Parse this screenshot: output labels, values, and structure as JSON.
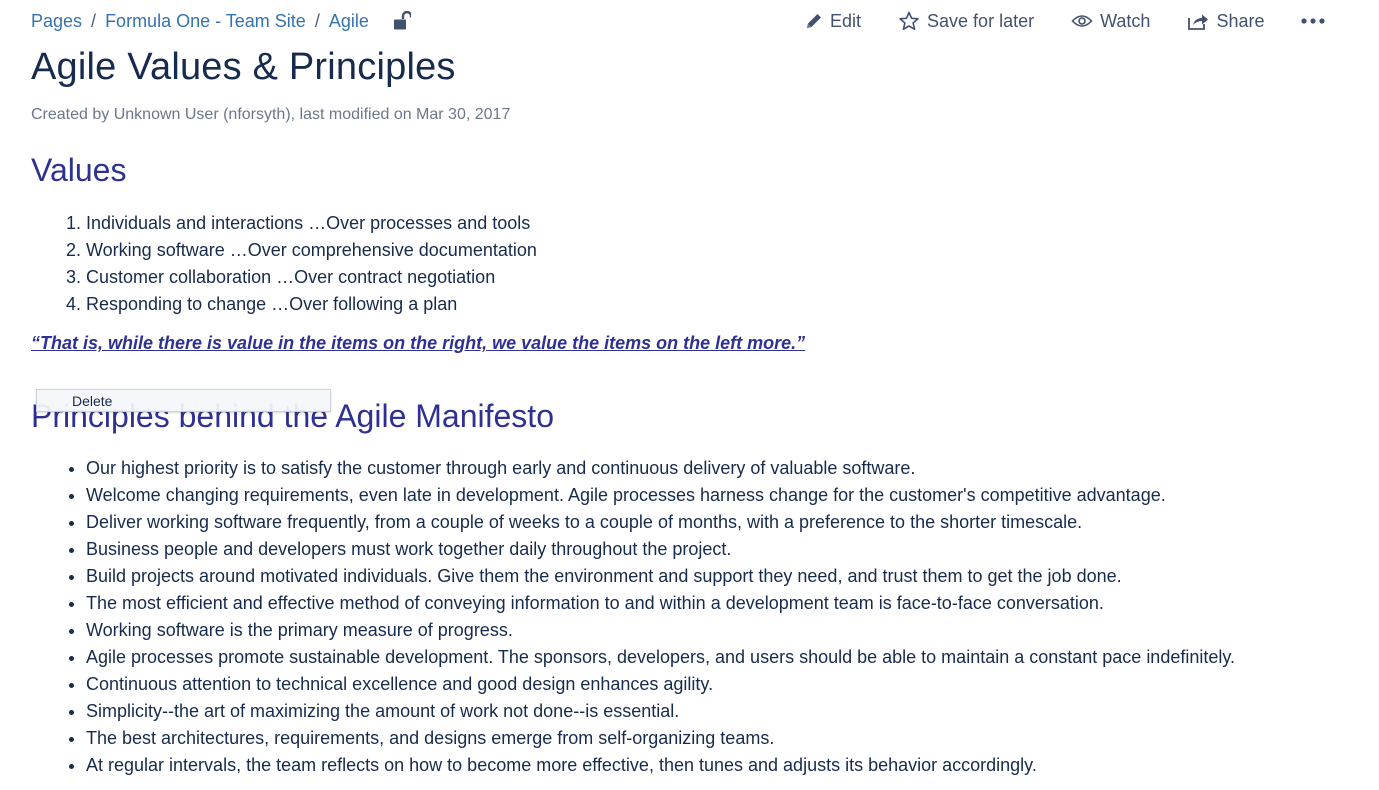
{
  "breadcrumbs": {
    "items": [
      "Pages",
      "Formula One - Team Site",
      "Agile"
    ],
    "separator": "/"
  },
  "actions": {
    "edit": "Edit",
    "save_for_later": "Save for later",
    "watch": "Watch",
    "share": "Share"
  },
  "page": {
    "title": "Agile Values & Principles",
    "byline": "Created by Unknown User (nforsyth), last modified on Mar 30, 2017"
  },
  "values_section": {
    "heading": "Values",
    "items": [
      "Individuals and interactions …Over processes and tools",
      "Working software …Over comprehensive documentation",
      "Customer collaboration …Over contract negotiation",
      "Responding to change …Over following a plan"
    ],
    "quote": "“That is, while there is value in the items on the right, we value the items on the left more.”"
  },
  "context_menu": {
    "delete_label": "Delete"
  },
  "principles_section": {
    "heading": "Principles behind the Agile Manifesto",
    "items": [
      "Our highest priority is to satisfy the customer through early and continuous delivery of valuable software.",
      "Welcome changing requirements, even late in development. Agile processes harness change for the customer's competitive advantage.",
      "Deliver working software frequently, from a couple of weeks to a couple of months, with a preference to the shorter timescale.",
      "Business people and developers must work together daily throughout the project.",
      "Build projects around motivated individuals. Give them the environment and support they need, and trust them to get the job done.",
      "The most efficient and effective method of conveying information to and within a development team is face-to-face conversation.",
      "Working software is the primary measure of progress.",
      "Agile processes promote sustainable development. The sponsors, developers, and users should be able to maintain a constant pace indefinitely.",
      "Continuous attention to technical excellence and good design enhances agility.",
      "Simplicity--the art of maximizing the amount of work not done--is essential.",
      "The best architectures, requirements, and designs emerge from self-organizing teams.",
      "At regular intervals, the team reflects on how to become more effective, then tunes and adjusts its behavior accordingly."
    ]
  },
  "icons": {
    "lock": "unlock-icon",
    "edit": "pencil-icon",
    "save": "star-icon",
    "watch": "eye-icon",
    "share": "share-icon",
    "more": "more-icon"
  },
  "colors": {
    "link": "#3572b0",
    "heading": "#2e3192",
    "text": "#172b4d",
    "meta": "#6b778c"
  }
}
